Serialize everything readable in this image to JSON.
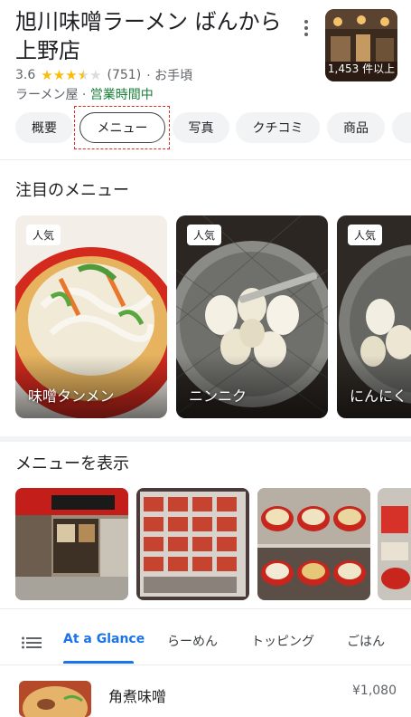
{
  "place": {
    "title_line1": "旭川味噌ラーメン ばんから",
    "title_line2": "上野店",
    "rating": "3.6",
    "stars": 3.5,
    "review_count": "(751)",
    "price_level": "· お手頃",
    "category": "ラーメン屋",
    "separator": " · ",
    "open_status": "営業時間中",
    "photo_count": "1,453 件以上"
  },
  "chips": [
    "概要",
    "メニュー",
    "写真",
    "クチコミ",
    "商品"
  ],
  "popular": {
    "heading": "注目のメニュー",
    "badge": "人気",
    "items": [
      "味噌タンメン",
      "ニンニク",
      "にんにく"
    ]
  },
  "menu_photos": {
    "heading": "メニューを表示"
  },
  "tabs": [
    "At a Glance",
    "らーめん",
    "トッピング",
    "ごはん"
  ],
  "menu_items": [
    {
      "name": "角煮味噌",
      "price": "¥1,080"
    }
  ],
  "colors": {
    "accent": "#1a73e8",
    "open": "#188038",
    "star": "#fbbc04",
    "highlight": "#d93025"
  }
}
